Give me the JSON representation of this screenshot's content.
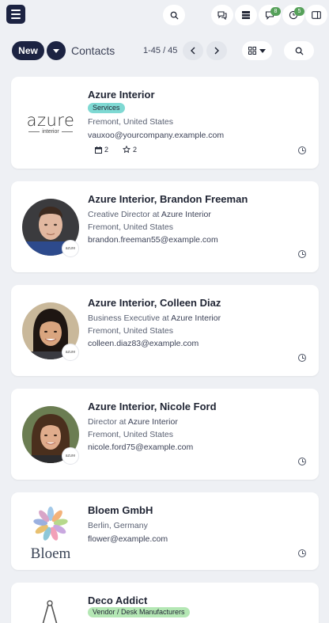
{
  "topbar": {
    "icons": [
      "menu-icon",
      "search-icon",
      "chat-icon",
      "server-icon",
      "chat-bubble-icon",
      "clock-icon",
      "sidebar-panel-icon"
    ],
    "messages_count": "8",
    "activities_count": "5"
  },
  "controlbar": {
    "new_label": "New",
    "breadcrumb": "Contacts",
    "pager": "1-45 / 45"
  },
  "contacts": [
    {
      "name": "Azure Interior",
      "tag": "Services",
      "tag_color": "#7fd9d3",
      "location": "Fremont, United States",
      "email": "vauxoo@yourcompany.example.com",
      "meetings": "2",
      "opportunities": "2",
      "logo_text": "azure",
      "logo_sub": "interior"
    },
    {
      "name": "Azure Interior, Brandon Freeman",
      "job": "Creative Director",
      "company": "Azure Interior",
      "at": "at",
      "location": "Fremont, United States",
      "email": "brandon.freeman55@example.com",
      "mini": "azure"
    },
    {
      "name": "Azure Interior, Colleen Diaz",
      "job": "Business Executive",
      "company": "Azure Interior",
      "at": "at",
      "location": "Fremont, United States",
      "email": "colleen.diaz83@example.com",
      "mini": "azure"
    },
    {
      "name": "Azure Interior, Nicole Ford",
      "job": "Director",
      "company": "Azure Interior",
      "at": "at",
      "location": "Fremont, United States",
      "email": "nicole.ford75@example.com",
      "mini": "azure"
    },
    {
      "name": "Bloem GmbH",
      "location": "Berlin, Germany",
      "email": "flower@example.com",
      "logo_text": "Bloem"
    },
    {
      "name": "Deco Addict",
      "tag": "Vendor / Desk Manufacturers",
      "tag_color": "#b4e7b4"
    }
  ]
}
